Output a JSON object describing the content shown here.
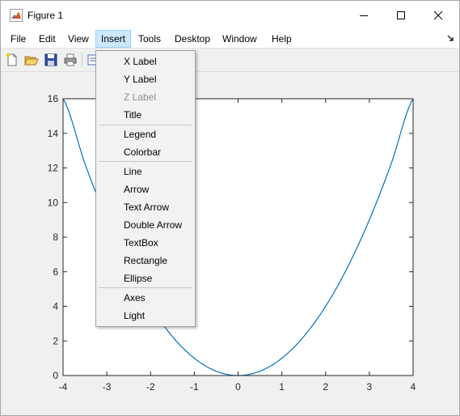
{
  "window": {
    "title": "Figure 1"
  },
  "menubar": {
    "items": [
      {
        "label": "File"
      },
      {
        "label": "Edit"
      },
      {
        "label": "View"
      },
      {
        "label": "Insert"
      },
      {
        "label": "Tools"
      },
      {
        "label": "Desktop"
      },
      {
        "label": "Window"
      },
      {
        "label": "Help"
      }
    ],
    "active": "Insert"
  },
  "toolbar": {
    "buttons": [
      "new-figure-icon",
      "open-file-icon",
      "save-icon",
      "print-icon",
      "print-preview-icon"
    ]
  },
  "insert_menu": {
    "items": [
      {
        "label": "X Label",
        "enabled": true
      },
      {
        "label": "Y Label",
        "enabled": true
      },
      {
        "label": "Z Label",
        "enabled": false
      },
      {
        "label": "Title",
        "enabled": true
      },
      {
        "label": "Legend",
        "enabled": true
      },
      {
        "label": "Colorbar",
        "enabled": true
      },
      {
        "label": "Line",
        "enabled": true
      },
      {
        "label": "Arrow",
        "enabled": true
      },
      {
        "label": "Text Arrow",
        "enabled": true
      },
      {
        "label": "Double Arrow",
        "enabled": true
      },
      {
        "label": "TextBox",
        "enabled": true
      },
      {
        "label": "Rectangle",
        "enabled": true
      },
      {
        "label": "Ellipse",
        "enabled": true
      },
      {
        "label": "Axes",
        "enabled": true
      },
      {
        "label": "Light",
        "enabled": true
      }
    ]
  },
  "chart_data": {
    "type": "line",
    "title": "",
    "xlabel": "",
    "ylabel": "",
    "xlim": [
      -4,
      4
    ],
    "ylim": [
      0,
      16
    ],
    "xticks": [
      -4,
      -3,
      -2,
      -1,
      0,
      1,
      2,
      3,
      4
    ],
    "yticks": [
      0,
      2,
      4,
      6,
      8,
      10,
      12,
      14,
      16
    ],
    "series": [
      {
        "color": "#0072bd",
        "x": [
          -4,
          -3.5,
          -3,
          -2.5,
          -2,
          -1.5,
          -1,
          -0.5,
          0,
          0.5,
          1,
          1.5,
          2,
          2.5,
          3,
          3.5,
          4
        ],
        "y": [
          16,
          12.25,
          9,
          6.25,
          4,
          2.25,
          1,
          0.25,
          0,
          0.25,
          1,
          2.25,
          4,
          6.25,
          9,
          12.25,
          16
        ]
      }
    ],
    "grid": false
  },
  "colors": {
    "menu_highlight": "#cce8ff",
    "line": "#0072bd"
  }
}
